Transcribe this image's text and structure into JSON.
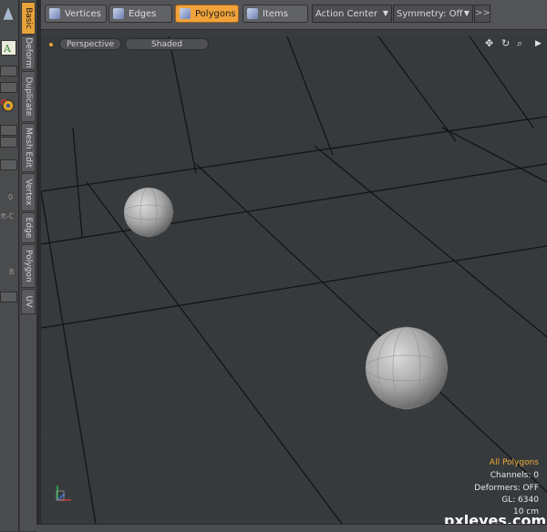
{
  "toolbar": {
    "modes": [
      {
        "label": "Vertices"
      },
      {
        "label": "Edges"
      },
      {
        "label": "Polygons",
        "active": true
      },
      {
        "label": "Items"
      }
    ],
    "action_center": "Action Center",
    "symmetry": "Symmetry: Off",
    "more": ">>"
  },
  "tabs": [
    "Basic",
    "Deform",
    "Duplicate",
    "Mesh Edit",
    "Vertex",
    "Edge",
    "Polygon",
    "UV"
  ],
  "rail_text": {
    "a": "0",
    "b": "ft-C",
    "c": "B"
  },
  "viewport": {
    "view": "Perspective",
    "shading": "Shaded"
  },
  "info": {
    "selection": "All Polygons",
    "channels": "Channels: 0",
    "deformers": "Deformers: OFF",
    "gl": "GL: 6340",
    "scale": "10 cm"
  },
  "watermark": "pxleyes.com",
  "colors": {
    "accent": "#e7a23a",
    "floor": "#343739",
    "grid_major": "#111111",
    "grid_minor": "#3d4145"
  }
}
